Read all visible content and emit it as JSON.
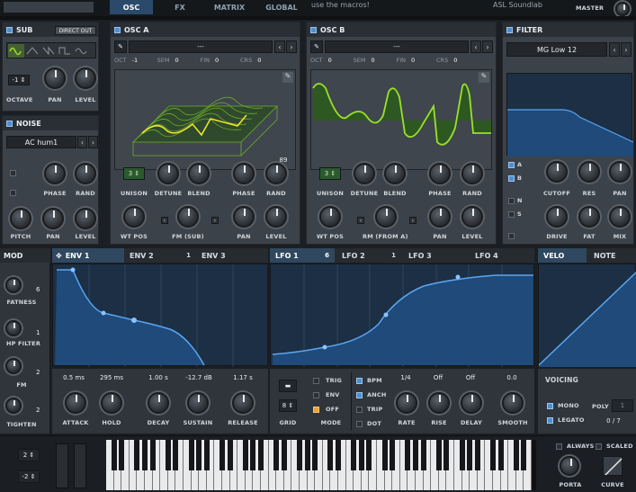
{
  "topbar": {
    "tabs": [
      "OSC",
      "FX",
      "MATRIX",
      "GLOBAL"
    ],
    "macro_hint": "use the macros!",
    "author": "ASL Soundlab",
    "master_label": "MASTER"
  },
  "sub": {
    "title": "SUB",
    "direct_out": "DIRECT OUT",
    "octave_value": "-1",
    "labels": [
      "OCTAVE",
      "PAN",
      "LEVEL"
    ]
  },
  "noise": {
    "title": "NOISE",
    "preset": "AC hum1",
    "labels": [
      "PHASE",
      "RAND",
      "PITCH",
      "PAN",
      "LEVEL"
    ]
  },
  "osc_a": {
    "title": "OSC A",
    "wavetable": "---",
    "params": [
      {
        "name": "OCT",
        "value": "-1"
      },
      {
        "name": "SEM",
        "value": "0"
      },
      {
        "name": "FIN",
        "value": "0"
      },
      {
        "name": "CRS",
        "value": "0"
      }
    ],
    "frame": "89",
    "unison": "3",
    "labels": [
      "UNISON",
      "DETUNE",
      "BLEND",
      "PHASE",
      "RAND",
      "WT POS",
      "FM (SUB)",
      "PAN",
      "LEVEL"
    ]
  },
  "osc_b": {
    "title": "OSC B",
    "wavetable": "---",
    "params": [
      {
        "name": "OCT",
        "value": "0"
      },
      {
        "name": "SEM",
        "value": "0"
      },
      {
        "name": "FIN",
        "value": "0"
      },
      {
        "name": "CRS",
        "value": "0"
      }
    ],
    "unison": "3",
    "labels": [
      "UNISON",
      "DETUNE",
      "BLEND",
      "PHASE",
      "RAND",
      "WT POS",
      "RM (FROM A)",
      "PAN",
      "LEVEL"
    ]
  },
  "filter": {
    "title": "FILTER",
    "type": "MG Low 12",
    "routes": [
      "A",
      "B",
      "N",
      "S"
    ],
    "labels": [
      "CUTOFF",
      "RES",
      "PAN",
      "DRIVE",
      "FAT",
      "MIX"
    ]
  },
  "mod": {
    "title": "MOD",
    "items": [
      {
        "label": "FATNESS",
        "num": "6"
      },
      {
        "label": "HP FILTER",
        "num": "1"
      },
      {
        "label": "FM",
        "num": "2"
      },
      {
        "label": "TIGHTEN",
        "num": "2"
      }
    ]
  },
  "env_tabs": [
    {
      "label": "ENV 1",
      "num": ""
    },
    {
      "label": "ENV 2",
      "num": "1"
    },
    {
      "label": "ENV 3",
      "num": ""
    }
  ],
  "lfo_tabs": [
    {
      "label": "LFO 1",
      "num": "6"
    },
    {
      "label": "LFO 2",
      "num": "1"
    },
    {
      "label": "LFO 3",
      "num": ""
    },
    {
      "label": "LFO 4",
      "num": ""
    }
  ],
  "velo_tabs": [
    "VELO",
    "NOTE"
  ],
  "env": {
    "values": [
      "0.5 ms",
      "295 ms",
      "1.00 s",
      "-12.7 dB",
      "1.17 s"
    ],
    "labels": [
      "ATTACK",
      "HOLD",
      "DECAY",
      "SUSTAIN",
      "RELEASE"
    ]
  },
  "lfo": {
    "grid_value": "8",
    "grid_label": "GRID",
    "modes": [
      "TRIG",
      "ENV",
      "OFF"
    ],
    "mode_label": "MODE",
    "options": [
      "BPM",
      "ANCH",
      "TRIP",
      "DOT"
    ],
    "values": [
      "1/4",
      "Off",
      "Off",
      "0.0"
    ],
    "labels": [
      "RATE",
      "RISE",
      "DELAY",
      "SMOOTH"
    ]
  },
  "voicing": {
    "title": "VOICING",
    "mono": "MONO",
    "legato": "LEGATO",
    "poly_label": "POLY",
    "poly_value": "1",
    "voices": "0 / 7"
  },
  "pitch": {
    "up": "2",
    "down": "-2"
  },
  "porta": {
    "always": "ALWAYS",
    "scaled": "SCALED",
    "porta_label": "PORTA",
    "curve_label": "CURVE"
  },
  "colors": {
    "accent": "#4a90d9",
    "wave": "#9be02c",
    "env_fill": "#1f4a7a"
  }
}
